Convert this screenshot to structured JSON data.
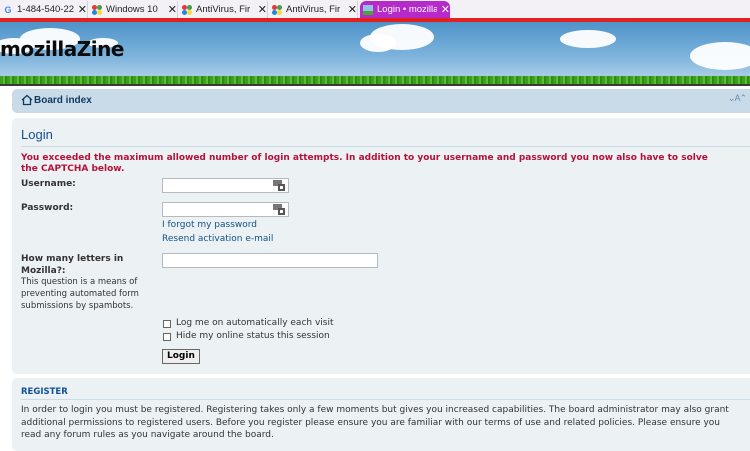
{
  "browser": {
    "tabs": [
      {
        "title": "1-484-540-22",
        "close": "✕",
        "favicon": "google-g-icon",
        "active": false
      },
      {
        "title": "Windows 10",
        "close": "✕",
        "favicon": "tenforums-icon",
        "active": false
      },
      {
        "title": "AntiVirus, Fir",
        "close": "✕",
        "favicon": "tenforums-icon",
        "active": false
      },
      {
        "title": "AntiVirus, Fir",
        "close": "✕",
        "favicon": "tenforums-icon",
        "active": false
      },
      {
        "title": "Login • mozilla",
        "close": "✕",
        "favicon": "mozillazine-icon",
        "active": true
      }
    ],
    "google_letter": "G",
    "accent": "#b52ac9",
    "bar_color": "#e32020"
  },
  "header": {
    "logo_text": "mozillaZine"
  },
  "nav": {
    "breadcrumb": "Board index",
    "font_size_control": "⌄A⌃"
  },
  "login": {
    "title": "Login",
    "error": "You exceeded the maximum allowed number of login attempts. In addition to your username and password you now also have to solve the CAPTCHA below.",
    "username_label": "Username:",
    "username_value": "",
    "password_label": "Password:",
    "password_value": "",
    "forgot_link": "I forgot my password",
    "resend_link": "Resend activation e-mail",
    "captcha_label": "How many letters in Mozilla?:",
    "captcha_explain": "This question is a means of preventing automated form submissions by spambots.",
    "captcha_value": "",
    "autologin_label": "Log me on automatically each visit",
    "hide_label": "Hide my online status this session",
    "submit_label": "Login"
  },
  "register": {
    "title": "REGISTER",
    "text": "In order to login you must be registered. Registering takes only a few moments but gives you increased capabilities. The board administrator may also grant additional permissions to registered users. Before you register please ensure you are familiar with our terms of use and related policies. Please ensure you read any forum rules as you navigate around the board."
  }
}
